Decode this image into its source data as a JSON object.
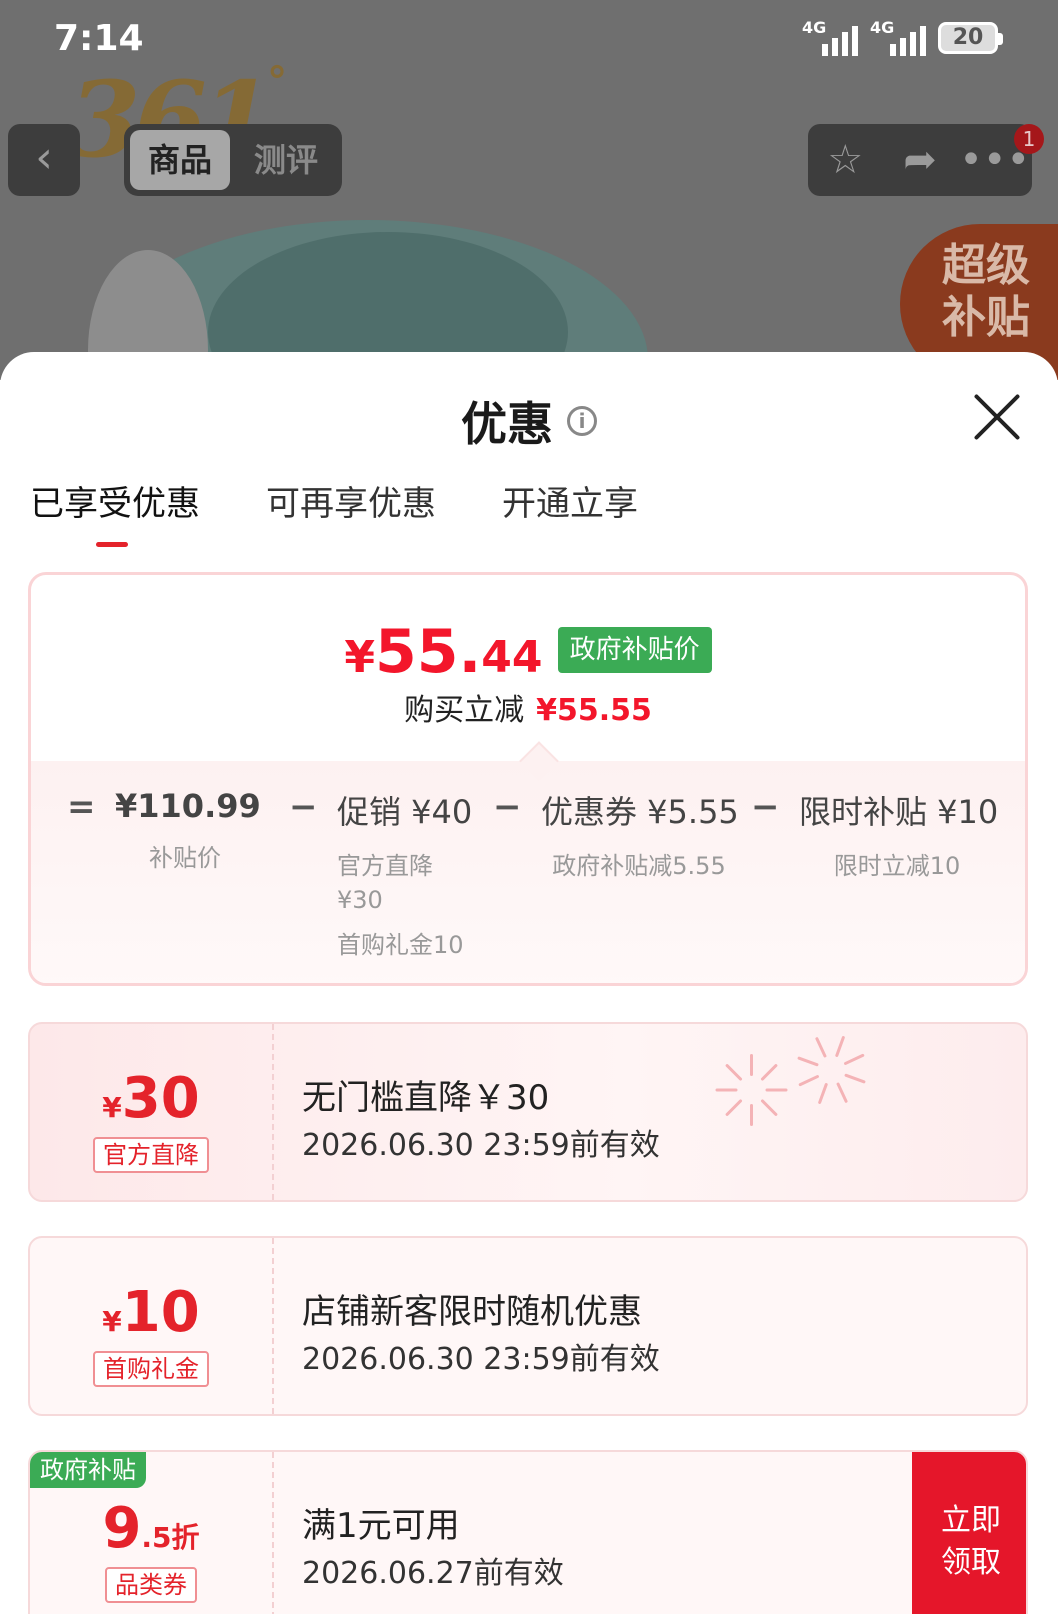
{
  "status_bar": {
    "time": "7:14",
    "network1": "4G",
    "network2": "4G",
    "battery": "20"
  },
  "background": {
    "logo_text": "361",
    "logo_mark": "°",
    "tabs": [
      "商品",
      "测评"
    ],
    "notification_count": "1",
    "promo_badge": [
      "超级",
      "补贴"
    ]
  },
  "sheet": {
    "title": "优惠",
    "tabs": [
      {
        "label": "已享受优惠",
        "active": true
      },
      {
        "label": "可再享优惠",
        "active": false
      },
      {
        "label": "开通立享",
        "active": false
      }
    ]
  },
  "summary": {
    "currency": "¥",
    "price_int": "55.",
    "price_dec": "44",
    "price_tag": "政府补贴价",
    "reduce_label": "购买立减",
    "reduce_amount": "¥55.55",
    "formula": [
      {
        "op": "=",
        "main": "¥110.99",
        "sub": "补贴价",
        "sub2": ""
      },
      {
        "op": "−",
        "main": "促销 ¥40",
        "sub": "官方直降¥30",
        "sub2": "首购礼金10"
      },
      {
        "op": "−",
        "main": "优惠券 ¥5.55",
        "sub": "政府补贴减5.55",
        "sub2": ""
      },
      {
        "op": "−",
        "main": "限时补贴 ¥10",
        "sub": "限时立减10",
        "sub2": ""
      }
    ]
  },
  "coupons": [
    {
      "yen": "¥",
      "amount": "30",
      "tag": "官方直降",
      "title": "无门槛直降￥30",
      "date": "2026.06.30 23:59前有效"
    },
    {
      "yen": "¥",
      "amount": "10",
      "tag": "首购礼金",
      "title": "店铺新客限时随机优惠",
      "date": "2026.06.30 23:59前有效"
    },
    {
      "corner": "政府补贴",
      "amount_big": "9",
      "amount_small": ".5折",
      "tag": "品类券",
      "title": "满1元可用",
      "date": "2026.06.27前有效",
      "button": [
        "立即",
        "领取"
      ]
    }
  ],
  "colors": {
    "accent_red": "#e4232b",
    "price_red": "#f3162b",
    "gov_green": "#3bab55"
  }
}
